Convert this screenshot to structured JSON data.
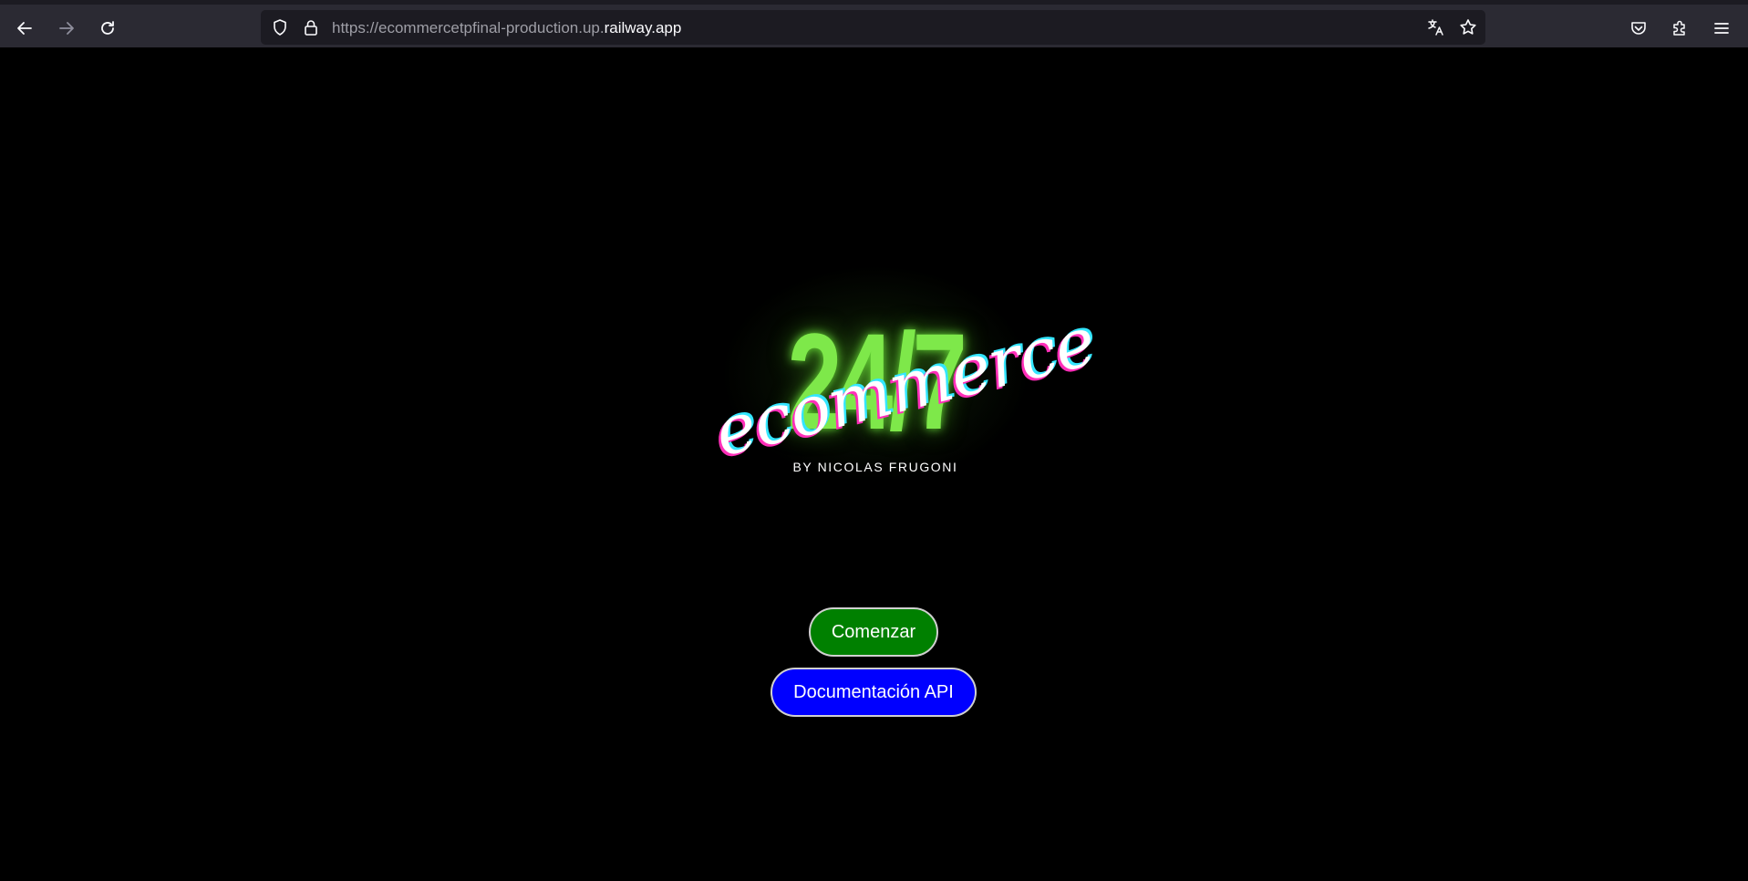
{
  "browser": {
    "url_prefix": "https://ecommercetpfinal-production.up.",
    "url_domain": "railway.app",
    "icons": {
      "back": "back-arrow-icon",
      "forward": "forward-arrow-icon",
      "reload": "reload-icon",
      "tracking_protection": "shield-icon",
      "secure": "lock-icon",
      "translate": "translate-icon",
      "bookmark": "star-icon",
      "pocket": "pocket-icon",
      "extensions": "extensions-icon",
      "menu": "hamburger-menu-icon"
    }
  },
  "logo": {
    "number": "24/7",
    "script": "ecommerce",
    "byline": "BY NICOLAS FRUGONI"
  },
  "buttons": {
    "start_label": "Comenzar",
    "docs_label": "Documentación API"
  },
  "colors": {
    "page_background": "#000000",
    "logo_green": "#7ee84a",
    "start_button": "#008000",
    "docs_button": "#0000ff"
  }
}
